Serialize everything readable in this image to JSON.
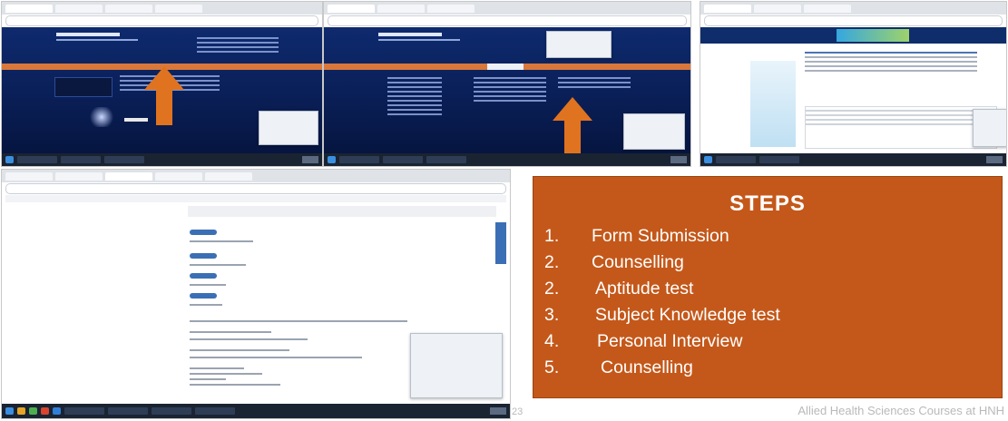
{
  "steps_panel": {
    "title": "STEPS",
    "items": [
      {
        "number": "1.",
        "label": "Form Submission"
      },
      {
        "number": "2.",
        "label": "Counselling"
      },
      {
        "number": "2.",
        "label": "Aptitude test"
      },
      {
        "number": "3.",
        "label": "Subject Knowledge test"
      },
      {
        "number": "4.",
        "label": "Personal Interview"
      },
      {
        "number": "5.",
        "label": "Counselling"
      }
    ]
  },
  "footer": {
    "caption": "Allied Health Sciences Courses at HNH",
    "page_number": "23"
  },
  "colors": {
    "steps_background": "#c4581a",
    "arrow": "#e0731f",
    "site_background": "#0e2a6e",
    "taskbar": "#1a2332"
  },
  "icons": [
    "arrow-up-icon",
    "windows-start-icon",
    "browser-tab-icon"
  ]
}
